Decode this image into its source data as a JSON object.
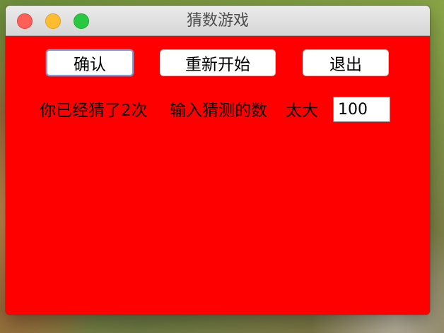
{
  "window": {
    "title": "猜数游戏"
  },
  "buttons": {
    "confirm": "确认",
    "restart": "重新开始",
    "exit": "退出"
  },
  "status": {
    "count_text": "你已经猜了2次",
    "prompt": "输入猜测的数",
    "hint": "太大"
  },
  "input": {
    "value": "100"
  },
  "colors": {
    "content_background": "#ff0000"
  }
}
